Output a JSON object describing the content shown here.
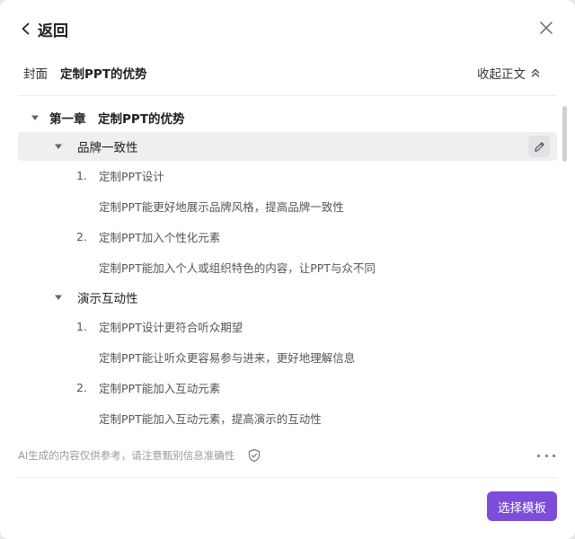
{
  "header": {
    "back_label": "返回"
  },
  "breadcrumb": {
    "cover": "封面",
    "title": "定制PPT的优势"
  },
  "collapse_label": "收起正文",
  "outline": {
    "chapter": "第一章　定制PPT的优势",
    "sections": [
      {
        "title": "品牌一致性",
        "items": [
          {
            "num": "1.",
            "title": "定制PPT设计",
            "desc": "定制PPT能更好地展示品牌风格，提高品牌一致性"
          },
          {
            "num": "2.",
            "title": "定制PPT加入个性化元素",
            "desc": "定制PPT能加入个人或组织特色的内容，让PPT与众不同"
          }
        ]
      },
      {
        "title": "演示互动性",
        "items": [
          {
            "num": "1.",
            "title": "定制PPT设计更符合听众期望",
            "desc": "定制PPT能让听众更容易参与进来，更好地理解信息"
          },
          {
            "num": "2.",
            "title": "定制PPT能加入互动元素",
            "desc": "定制PPT能加入互动元素，提高演示的互动性"
          }
        ]
      }
    ]
  },
  "footer": {
    "disclaimer": "AI生成的内容仅供参考，请注意甄别信息准确性",
    "primary_button": "选择模板"
  },
  "colors": {
    "primary": "#7c4ddb",
    "highlight_row": "#efeff2"
  }
}
